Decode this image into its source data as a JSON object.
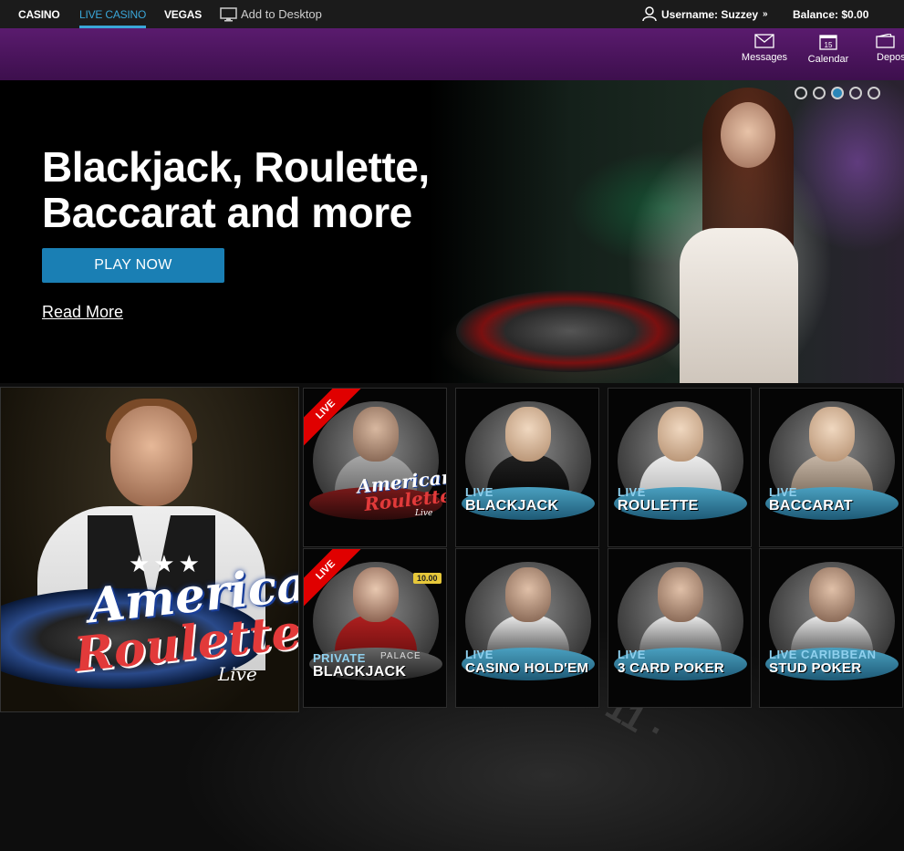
{
  "nav": {
    "casino": "CASINO",
    "live_casino": "LIVE CASINO",
    "vegas": "VEGAS",
    "add_to_desktop": "Add to Desktop",
    "username": "Username: Suzzey",
    "balance": "Balance: $0.00"
  },
  "toolbar": {
    "messages": "Messages",
    "calendar": "Calendar",
    "calendar_day": "15",
    "deposit": "Depos"
  },
  "hero": {
    "title_line1": "Blackjack, Roulette,",
    "title_line2": "Baccarat and more",
    "play_label": "PLAY NOW",
    "read_more": "Read More",
    "slide_count": 5,
    "active_slide": 3
  },
  "feature": {
    "logo_line1": "American",
    "logo_line2": "Roulette",
    "logo_line3": "Live",
    "stars": "★★★"
  },
  "tiles": [
    {
      "ribbon": "LIVE",
      "logo1": "American",
      "logo2": "Roulette",
      "logo3": "Live"
    },
    {
      "top": "LIVE",
      "main": "BLACKJACK"
    },
    {
      "top": "LIVE",
      "main": "ROULETTE"
    },
    {
      "top": "LIVE",
      "main": "BACCARAT"
    },
    {
      "ribbon": "LIVE",
      "chip": "10.00",
      "top": "PRIVATE",
      "main": "BLACKJACK",
      "palace": "PALACE"
    },
    {
      "top": "LIVE",
      "main": "CASINO HOLD'EM"
    },
    {
      "top": "LIVE",
      "main": "3 CARD POKER"
    },
    {
      "top": "LIVE CARIBBEAN",
      "main": "STUD POKER"
    }
  ],
  "colors": {
    "accent": "#3aa6d8",
    "play_button": "#1a7fb4",
    "purple": "#4a1660",
    "live_red": "#e00000"
  }
}
